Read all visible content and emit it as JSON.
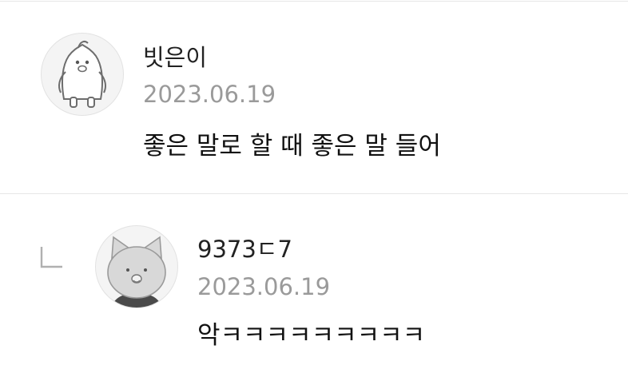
{
  "comments": [
    {
      "nickname": "빗은이",
      "date": "2023.06.19",
      "text": "좋은 말로 할 때 좋은 말 들어",
      "avatar_icon": "penguin-avatar-icon"
    }
  ],
  "replies": [
    {
      "nickname": "9373ㄷ7",
      "date": "2023.06.19",
      "text": "악ㅋㅋㅋㅋㅋㅋㅋㅋㅋ",
      "avatar_icon": "cat-avatar-icon"
    }
  ],
  "icons": {
    "reply": "reply-arrow-icon"
  }
}
